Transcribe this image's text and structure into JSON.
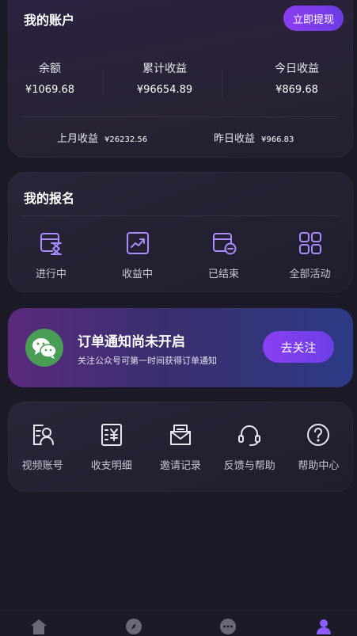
{
  "account": {
    "title": "我的账户",
    "withdraw_label": "立即提现",
    "stats": [
      {
        "label": "余额",
        "value": "¥1069.68"
      },
      {
        "label": "累计收益",
        "value": "¥96654.89"
      },
      {
        "label": "今日收益",
        "value": "¥869.68"
      }
    ],
    "sub_stats": [
      {
        "label": "上月收益",
        "value": "¥26232.56"
      },
      {
        "label": "昨日收益",
        "value": "¥966.83"
      }
    ]
  },
  "signup": {
    "title": "我的报名",
    "items": [
      {
        "label": "进行中",
        "icon": "hourglass-calendar-icon"
      },
      {
        "label": "收益中",
        "icon": "trend-chart-icon"
      },
      {
        "label": "已结束",
        "icon": "ended-calendar-icon"
      },
      {
        "label": "全部活动",
        "icon": "grid-apps-icon"
      }
    ]
  },
  "notify": {
    "title": "订单通知尚未开启",
    "subtitle": "关注公众号可第一时间获得订单通知",
    "button": "去关注",
    "icon": "wechat-icon"
  },
  "tools": {
    "items": [
      {
        "label": "视频账号",
        "icon": "video-account-icon"
      },
      {
        "label": "收支明细",
        "icon": "ledger-icon"
      },
      {
        "label": "邀请记录",
        "icon": "invite-mail-icon"
      },
      {
        "label": "反馈与帮助",
        "icon": "headset-icon"
      },
      {
        "label": "帮助中心",
        "icon": "help-circle-icon"
      }
    ]
  },
  "bottom_nav": {
    "items": [
      "home-icon",
      "discover-icon",
      "message-icon",
      "profile-icon"
    ]
  },
  "colors": {
    "accent": "#8c3df0",
    "icon_purple": "#a98cff",
    "wechat_green": "#4a9d55"
  }
}
